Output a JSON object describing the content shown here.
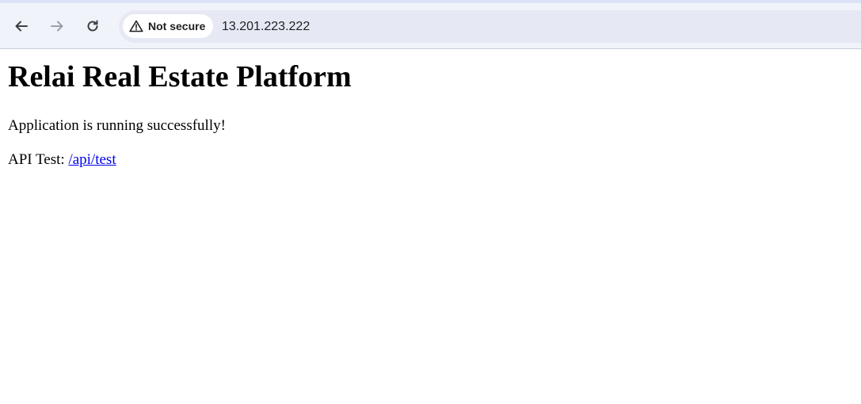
{
  "browser": {
    "security_label": "Not secure",
    "url": "13.201.223.222",
    "icons": {
      "back": "arrow-left-icon",
      "forward": "arrow-right-icon",
      "reload": "reload-icon",
      "security": "warning-triangle-icon"
    }
  },
  "page": {
    "heading": "Relai Real Estate Platform",
    "status_message": "Application is running successfully!",
    "api_label": "API Test:",
    "api_link_text": "/api/test"
  },
  "colors": {
    "link": "#0000ee",
    "chrome_background": "#f1f3fb",
    "omnibox_background": "#e6e9f4"
  }
}
